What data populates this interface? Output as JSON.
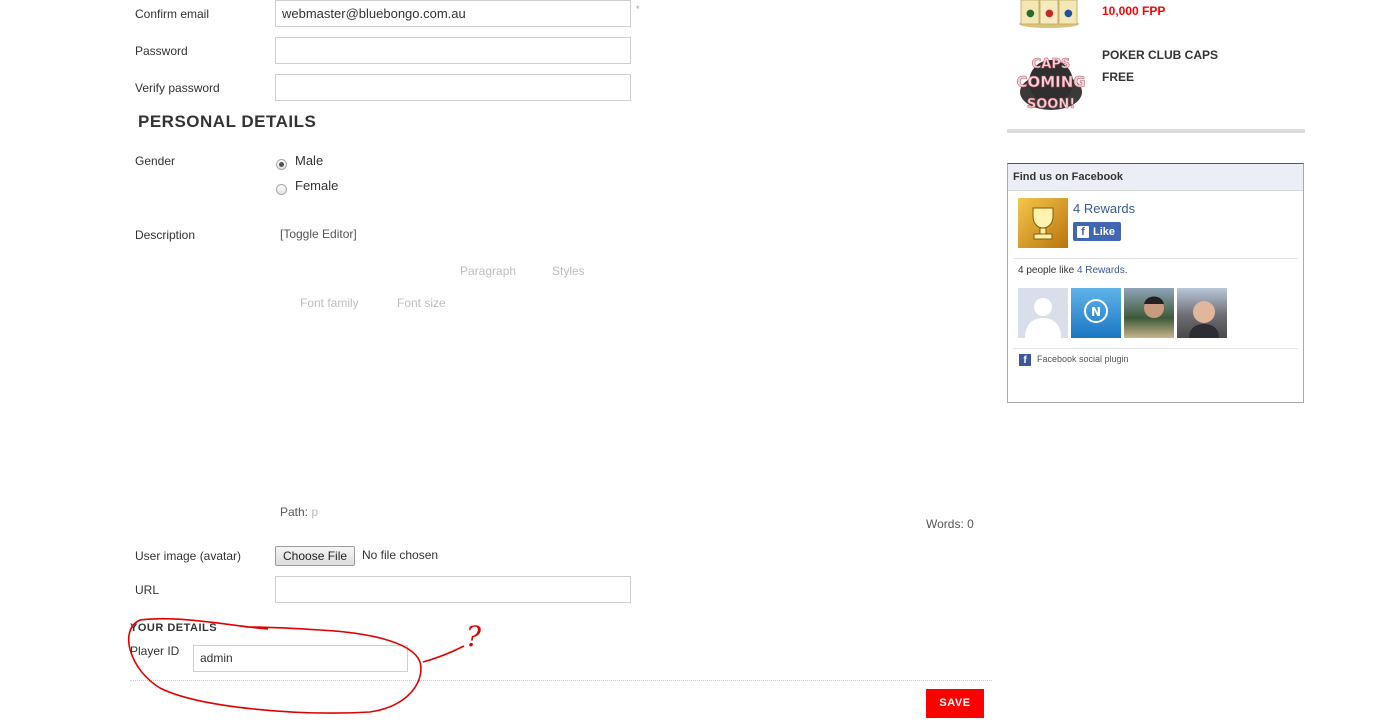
{
  "account": {
    "confirm_email_label": "Confirm email",
    "confirm_email_value": "webmaster@bluebongo.com.au",
    "required_mark": "*",
    "password_label": "Password",
    "verify_password_label": "Verify password"
  },
  "personal": {
    "title": "PERSONAL DETAILS",
    "gender_label": "Gender",
    "gender_options": [
      "Male",
      "Female"
    ],
    "gender_selected": "Male",
    "description_label": "Description",
    "toggle_editor": "[Toggle Editor]",
    "toolbar": {
      "paragraph": "Paragraph",
      "styles": "Styles",
      "font_family": "Font family",
      "font_size": "Font size"
    },
    "path_label": "Path:",
    "path_value": "p",
    "words": "Words: 0",
    "avatar_label": "User image (avatar)",
    "choose_file": "Choose File",
    "no_file": "No file chosen",
    "url_label": "URL"
  },
  "your_details": {
    "title": "YOUR DETAILS",
    "player_id_label": "Player ID",
    "player_id_value": "admin",
    "annotation_mark": "?"
  },
  "save_label": "SAVE",
  "rewards": [
    {
      "name": "",
      "price": "10,000 FPP",
      "image_icon": "mahjong-tiles-icon"
    },
    {
      "name": "POKER CLUB CAPS",
      "price": "FREE",
      "image_text": [
        "CAPS",
        "COMING",
        "SOON!"
      ]
    }
  ],
  "facebook": {
    "header": "Find us on Facebook",
    "page_name": "4 Rewards",
    "like_label": "Like",
    "people_like_prefix": "4 people like",
    "people_like_link": "4 Rewards",
    "people_like_suffix": ".",
    "plugin_label": "Facebook social plugin",
    "brand_color": "#3b5998"
  },
  "colors": {
    "accent_red": "#ff0000",
    "annotation_red": "#e00000"
  }
}
